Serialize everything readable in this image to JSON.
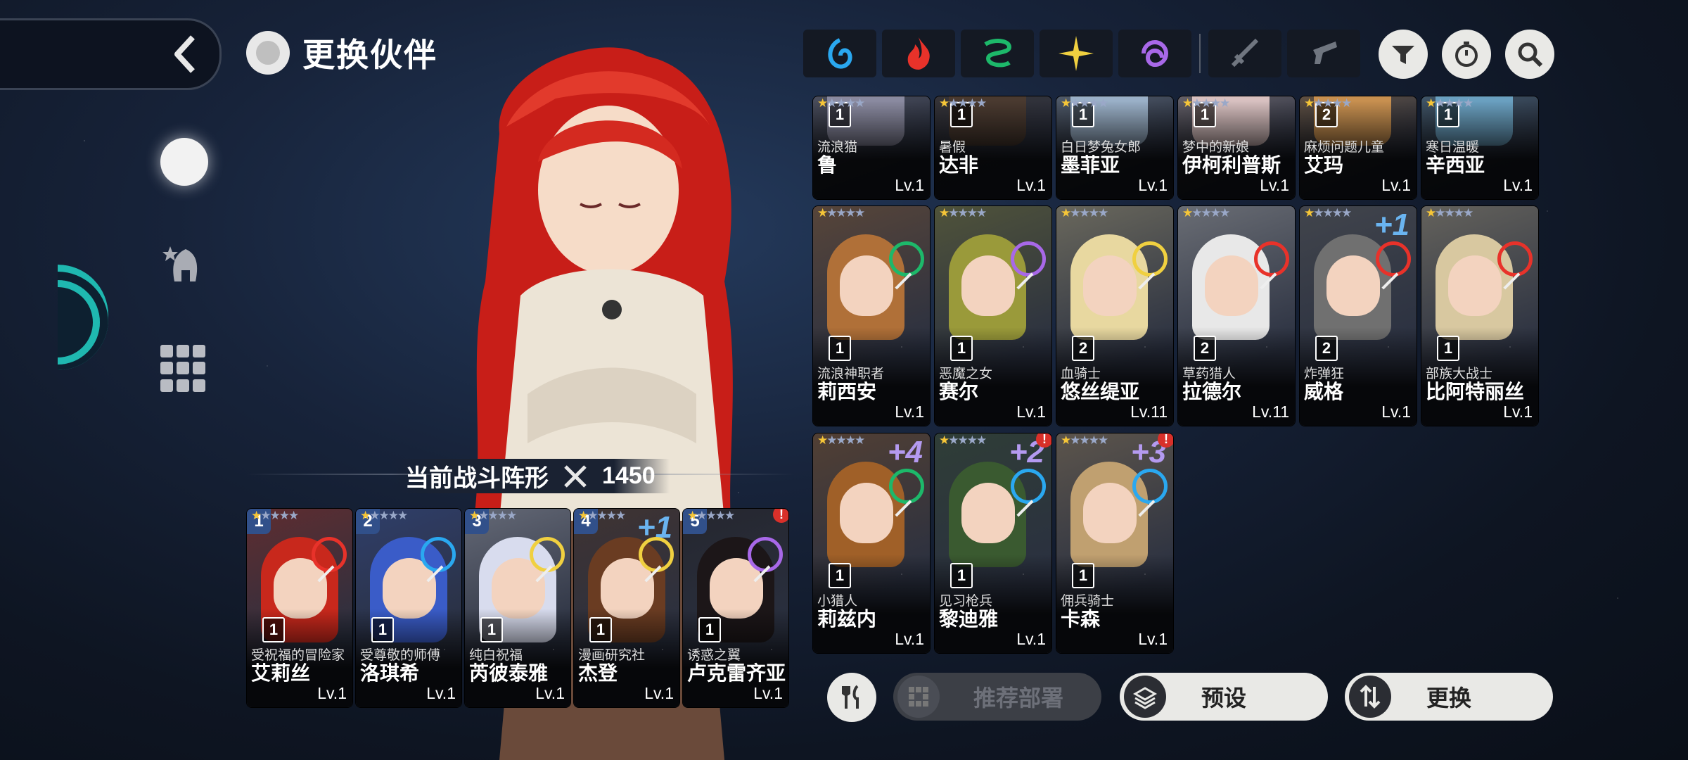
{
  "header": {
    "title": "更换伙伴"
  },
  "formation": {
    "label": "当前战斗阵形",
    "power": "1450"
  },
  "colors": {
    "water": "#2aa8f0",
    "fire": "#e8322a",
    "wind": "#1db86a",
    "light": "#f0d040",
    "dark": "#a868e8"
  },
  "filters": {
    "elements": [
      {
        "icon": "water-element-icon",
        "color": "#2aa8f0"
      },
      {
        "icon": "fire-element-icon",
        "color": "#e8322a"
      },
      {
        "icon": "wind-element-icon",
        "color": "#1db86a"
      },
      {
        "icon": "light-element-icon",
        "color": "#f0d040"
      },
      {
        "icon": "dark-element-icon",
        "color": "#a868e8"
      }
    ],
    "weapons": [
      {
        "icon": "sword-icon"
      },
      {
        "icon": "gun-icon"
      }
    ],
    "right_buttons": [
      {
        "icon": "sort-filter-icon"
      },
      {
        "icon": "timer-icon"
      },
      {
        "icon": "search-icon"
      }
    ]
  },
  "team": [
    {
      "slot": "1",
      "title": "受祝福的冒险家",
      "name": "艾莉丝",
      "rank": "1",
      "stars": 1,
      "lv": "Lv.1",
      "element": "fire",
      "hair": "#c8281c"
    },
    {
      "slot": "2",
      "title": "受尊敬的师傅",
      "name": "洛琪希",
      "rank": "1",
      "stars": 1,
      "lv": "Lv.1",
      "element": "water",
      "hair": "#3a5cc8"
    },
    {
      "slot": "3",
      "title": "纯白祝福",
      "name": "芮彼泰雅",
      "rank": "1",
      "stars": 1,
      "lv": "Lv.1",
      "element": "light",
      "hair": "#d8dcee"
    },
    {
      "slot": "4",
      "title": "漫画研究社",
      "name": "杰登",
      "rank": "1",
      "stars": 1,
      "lv": "Lv.1",
      "element": "light",
      "hair": "#6a3c22",
      "plus": "+1"
    },
    {
      "slot": "5",
      "title": "诱惑之翼",
      "name": "卢克雷齐亚",
      "rank": "1",
      "stars": 1,
      "lv": "Lv.1",
      "element": "dark",
      "hair": "#1c1618",
      "alert": "!"
    }
  ],
  "roster_row1": [
    {
      "title": "流浪猫",
      "name": "鲁",
      "rank": "1",
      "stars": 1,
      "lv": "Lv.1",
      "hair": "#8a8aa0"
    },
    {
      "title": "暑假",
      "name": "达非",
      "rank": "1",
      "stars": 1,
      "lv": "Lv.1",
      "hair": "#4a3a30"
    },
    {
      "title": "白日梦兔女郎",
      "name": "墨菲亚",
      "rank": "1",
      "stars": 1,
      "lv": "Lv.1",
      "hair": "#9ab0c8"
    },
    {
      "title": "梦中的新娘",
      "name": "伊柯利普斯",
      "rank": "1",
      "stars": 1,
      "lv": "Lv.1",
      "hair": "#d8c0c0"
    },
    {
      "title": "麻烦问题儿童",
      "name": "艾玛",
      "rank": "2",
      "stars": 1,
      "lv": "Lv.1",
      "hair": "#c89050"
    },
    {
      "title": "寒日温暖",
      "name": "辛西亚",
      "rank": "1",
      "stars": 1,
      "lv": "Lv.1",
      "hair": "#6aa0c0"
    }
  ],
  "roster_row2": [
    {
      "title": "流浪神职者",
      "name": "莉西安",
      "rank": "1",
      "stars": 1,
      "lv": "Lv.1",
      "element": "wind",
      "hair": "#b07038"
    },
    {
      "title": "恶魔之女",
      "name": "赛尔",
      "rank": "1",
      "stars": 1,
      "lv": "Lv.1",
      "element": "dark",
      "hair": "#9a9a3a"
    },
    {
      "title": "血骑士",
      "name": "悠丝缇亚",
      "rank": "2",
      "stars": 1,
      "lv": "Lv.11",
      "element": "light",
      "hair": "#e8d8a0"
    },
    {
      "title": "草药猎人",
      "name": "拉德尔",
      "rank": "2",
      "stars": 1,
      "lv": "Lv.11",
      "element": "fire",
      "hair": "#e8e8e8"
    },
    {
      "title": "炸弹狂",
      "name": "威格",
      "rank": "2",
      "stars": 1,
      "lv": "Lv.1",
      "element": "fire",
      "hair": "#707070",
      "plus": "+1"
    },
    {
      "title": "部族大战士",
      "name": "比阿特丽丝",
      "rank": "1",
      "stars": 1,
      "lv": "Lv.1",
      "element": "fire",
      "hair": "#d8c8a0"
    }
  ],
  "roster_row3": [
    {
      "title": "小猎人",
      "name": "莉兹内",
      "rank": "1",
      "stars": 1,
      "lv": "Lv.1",
      "element": "wind",
      "hair": "#a06028",
      "plus": "+4"
    },
    {
      "title": "见习枪兵",
      "name": "黎迪雅",
      "rank": "1",
      "stars": 1,
      "lv": "Lv.1",
      "element": "water",
      "hair": "#3a5a30",
      "plus": "+2",
      "alert": "!"
    },
    {
      "title": "佣兵骑士",
      "name": "卡森",
      "rank": "1",
      "stars": 1,
      "lv": "Lv.1",
      "element": "water",
      "hair": "#c0a070",
      "plus": "+3",
      "alert": "!"
    }
  ],
  "buttons": {
    "recommend": "推荐部署",
    "preset": "预设",
    "replace": "更换"
  }
}
